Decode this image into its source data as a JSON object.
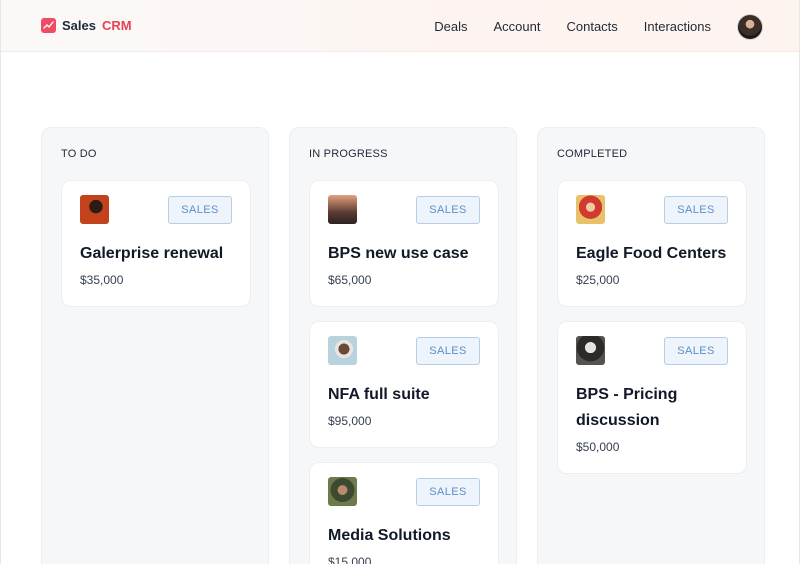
{
  "header": {
    "brand_main": "Sales",
    "brand_accent": "CRM",
    "nav": [
      "Deals",
      "Account",
      "Contacts",
      "Interactions"
    ]
  },
  "board": {
    "columns": [
      {
        "title": "TO DO",
        "cards": [
          {
            "title": "Galerprise renewal",
            "amount": "$35,000",
            "tag": "SALES"
          }
        ]
      },
      {
        "title": "IN PROGRESS",
        "cards": [
          {
            "title": "BPS new use case",
            "amount": "$65,000",
            "tag": "SALES"
          },
          {
            "title": "NFA full suite",
            "amount": "$95,000",
            "tag": "SALES"
          },
          {
            "title": "Media Solutions",
            "amount": "$15,000",
            "tag": "SALES"
          }
        ]
      },
      {
        "title": "COMPLETED",
        "cards": [
          {
            "title": "Eagle Food Centers",
            "amount": "$25,000",
            "tag": "SALES"
          },
          {
            "title": "BPS - Pricing discussion",
            "amount": "$50,000",
            "tag": "SALES"
          }
        ]
      }
    ]
  },
  "colors": {
    "brand": "#ef4c63",
    "badge_text": "#5b8fc6",
    "badge_bg": "#eef4fb",
    "column_bg": "#f6f7f9"
  }
}
